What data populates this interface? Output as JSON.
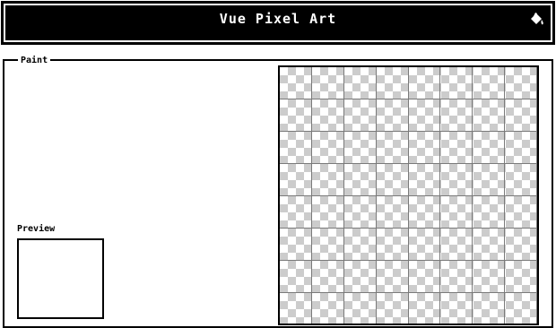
{
  "header": {
    "title": "Vue Pixel Art",
    "icon": "paint-bucket-icon"
  },
  "paint_panel": {
    "legend": "Paint"
  },
  "preview": {
    "label": "Preview"
  },
  "canvas": {
    "columns": 8,
    "rows_visible": 8
  }
}
